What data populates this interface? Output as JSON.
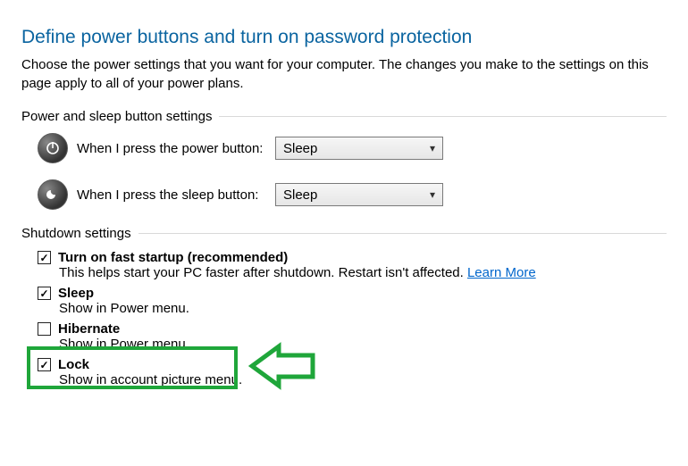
{
  "title": "Define power buttons and turn on password protection",
  "description": "Choose the power settings that you want for your computer. The changes you make to the settings on this page apply to all of your power plans.",
  "group1": {
    "header": "Power and sleep button settings",
    "power_label": "When I press the power button:",
    "power_value": "Sleep",
    "sleep_label": "When I press the sleep button:",
    "sleep_value": "Sleep"
  },
  "group2": {
    "header": "Shutdown settings",
    "fast_startup": {
      "label": "Turn on fast startup (recommended)",
      "desc": "This helps start your PC faster after shutdown. Restart isn't affected.",
      "link": "Learn More",
      "checked": true
    },
    "sleep": {
      "label": "Sleep",
      "desc": "Show in Power menu.",
      "checked": true
    },
    "hibernate": {
      "label": "Hibernate",
      "desc": "Show in Power menu.",
      "checked": false
    },
    "lock": {
      "label": "Lock",
      "desc": "Show in account picture menu.",
      "checked": true
    }
  }
}
